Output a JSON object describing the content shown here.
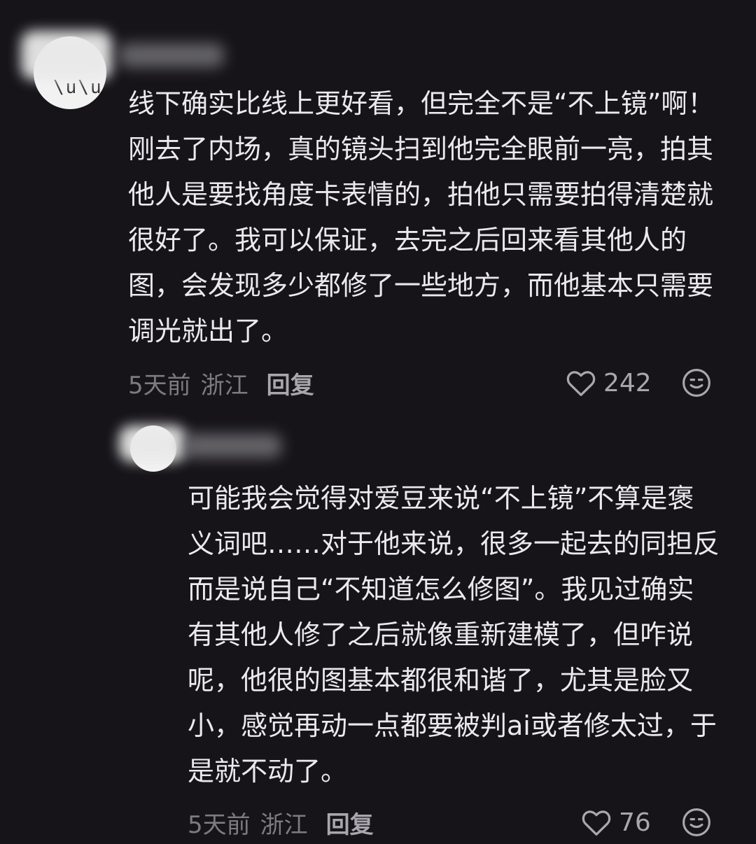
{
  "comments": [
    {
      "text": "线下确实比线上更好看，但完全不是“不上镜”啊！刚去了内场，真的镜头扫到他完全眼前一亮，拍其他人是要找角度卡表情的，拍他只需要拍得清楚就很好了。我可以保证，去完之后回来看其他人的图，会发现多少都修了一些地方，而他基本只需要调光就出了。",
      "time": "5天前",
      "location": "浙江",
      "reply_label": "回复",
      "likes": "242",
      "like_icon": "heart-outline-icon",
      "reaction_icon": "face-emoji-icon"
    },
    {
      "text": "可能我会觉得对爱豆来说“不上镜”不算是褒义词吧……对于他来说，很多一起去的同担反而是说自己“不知道怎么修图”。我见过确实有其他人修了之后就像重新建模了，但咋说呢，他很的图基本都很和谐了，尤其是脸又小，感觉再动一点都要被判ai或者修太过，于是就不动了。",
      "time": "5天前",
      "location": "浙江",
      "reply_label": "回复",
      "likes": "76",
      "like_icon": "heart-outline-icon",
      "reaction_icon": "face-emoji-icon"
    }
  ],
  "colors": {
    "background": "#161419",
    "text": "#ebe9ee",
    "meta": "#7d7b82",
    "icon": "#a9a7ad"
  }
}
